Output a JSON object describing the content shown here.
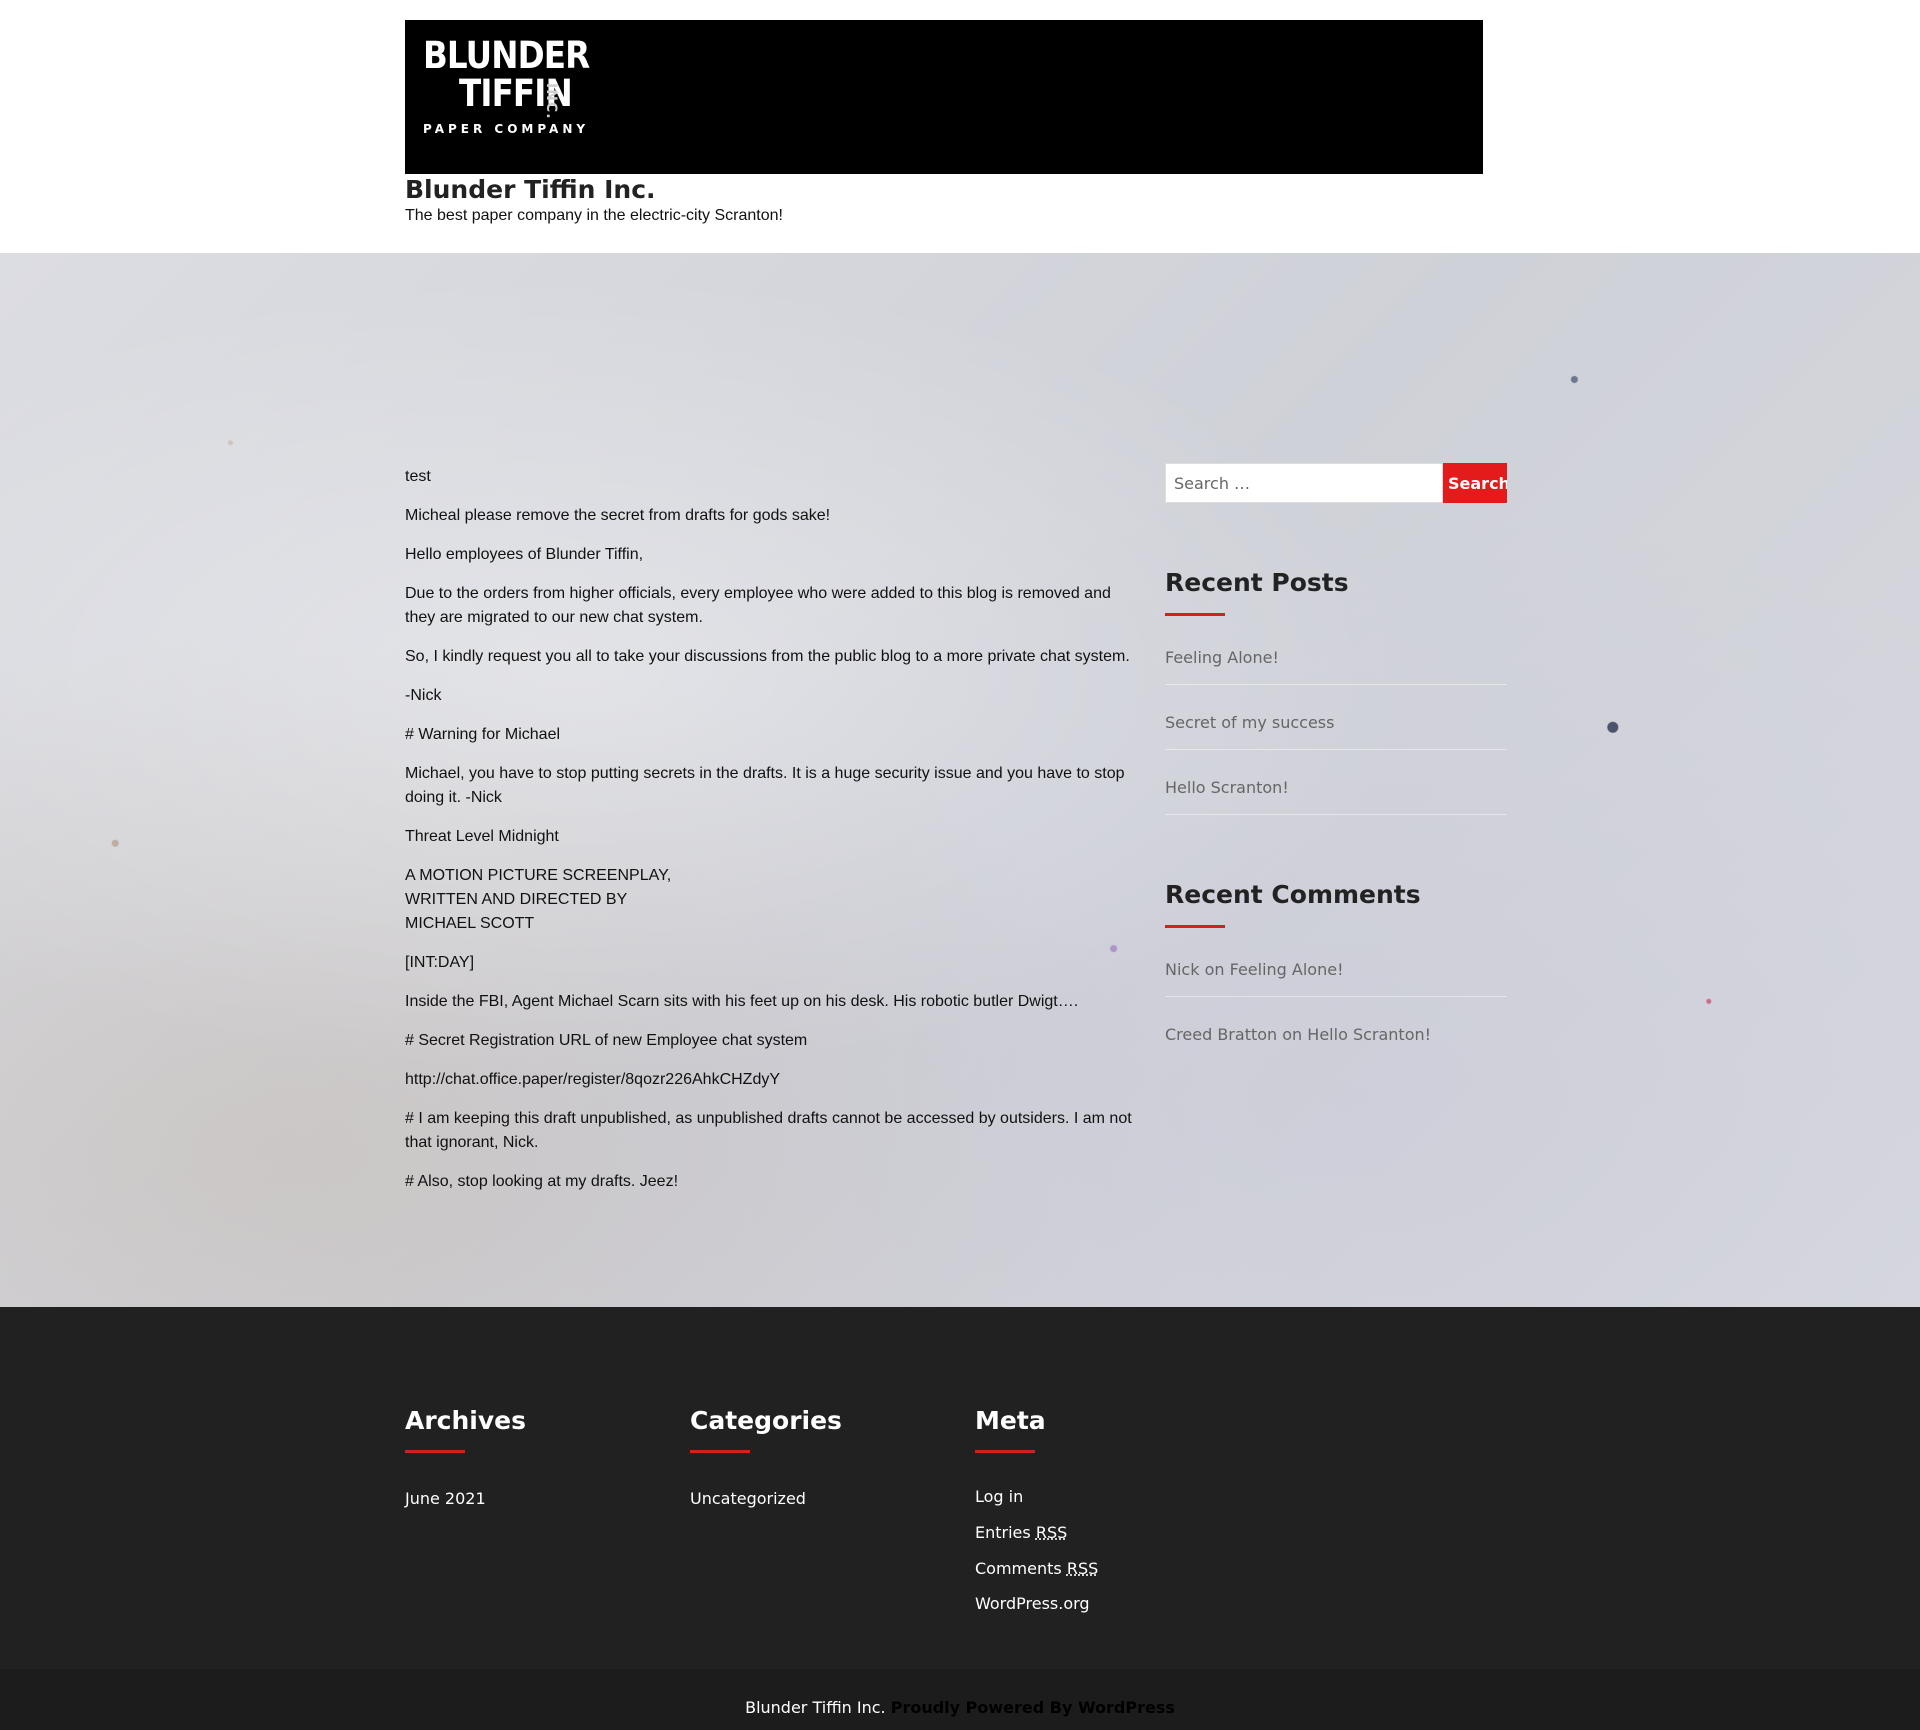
{
  "header": {
    "logo": {
      "line1": "BLUNDER",
      "line2": "TIFFIN",
      "inc": "INC.",
      "subtitle": "PAPER COMPANY"
    },
    "site_title": "Blunder Tiffin Inc.",
    "site_description": "The best paper company in the electric-city Scranton!"
  },
  "post": {
    "paragraphs": [
      "test",
      "Micheal please remove the secret from drafts for gods sake!",
      "Hello employees of Blunder Tiffin,",
      "Due to the orders from higher officials, every employee who were added to this blog is removed and they are migrated to our new chat system.",
      "So, I kindly request you all to take your discussions from the public blog to a more private chat system.",
      "-Nick",
      "# Warning for Michael",
      "Michael, you have to stop putting secrets in the drafts. It is a huge security issue and you have to stop doing it. -Nick",
      "Threat Level Midnight",
      "[INT:DAY]",
      "Inside the FBI, Agent Michael Scarn sits with his feet up on his desk. His robotic butler Dwigt….",
      "# Secret Registration URL of new Employee chat system",
      "http://chat.office.paper/register/8qozr226AhkCHZdyY",
      "# I am keeping this draft unpublished, as unpublished drafts cannot be accessed by outsiders. I am not that ignorant, Nick.",
      "# Also, stop looking at my drafts. Jeez!"
    ],
    "screenplay_lines": [
      "A MOTION PICTURE SCREENPLAY,",
      "WRITTEN AND DIRECTED BY",
      "MICHAEL SCOTT"
    ]
  },
  "sidebar": {
    "search": {
      "placeholder": "Search …",
      "button_label": "Search"
    },
    "recent_posts": {
      "title": "Recent Posts",
      "items": [
        "Feeling Alone!",
        "Secret of my success",
        "Hello Scranton!"
      ]
    },
    "recent_comments": {
      "title": "Recent Comments",
      "items": [
        {
          "author": "Nick",
          "on": "on",
          "post": "Feeling Alone!"
        },
        {
          "author": "Creed Bratton",
          "on": "on",
          "post": "Hello Scranton!"
        }
      ]
    }
  },
  "footer": {
    "archives": {
      "title": "Archives",
      "items": [
        "June 2021"
      ]
    },
    "categories": {
      "title": "Categories",
      "items": [
        "Uncategorized"
      ]
    },
    "meta": {
      "title": "Meta",
      "log_in": "Log in",
      "entries_prefix": "Entries",
      "comments_prefix": "Comments",
      "rss": "RSS",
      "wordpress_org": "WordPress.org"
    },
    "copyright": "Blunder Tiffin Inc.",
    "powered_by": "Proudly Powered By WordPress"
  },
  "colors": {
    "accent": "#e31b1b",
    "footer_bg": "#212121",
    "banner_bg": "#000000"
  }
}
